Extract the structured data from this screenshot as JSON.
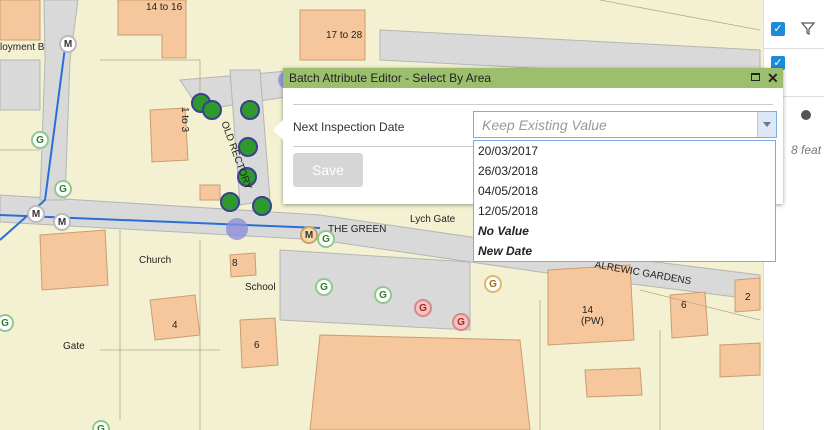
{
  "map": {
    "labels": {
      "house_14to16": "14 to 16",
      "house_17to28": "17 to 28",
      "employment": "loyment B",
      "road_1to3": "1 to 3",
      "old_rectory": "OLD RECTORY",
      "the_green": "THE GREEN",
      "lych_gate": "Lych Gate",
      "church": "Church",
      "school": "School",
      "num_8": "8",
      "num_4": "4",
      "num_6": "6",
      "num_6b": "6",
      "num_14": "14",
      "pw": "(PW)",
      "alrewic": "ALREWIC GARDENS",
      "gate": "Gate",
      "num_2": "2"
    },
    "markers": {
      "g": "G",
      "m": "M",
      "r": "G"
    }
  },
  "side": {
    "feature_count": "8 feat"
  },
  "dialog": {
    "title": "Batch Attribute Editor - Select By Area",
    "field_label": "Next Inspection Date",
    "combo_placeholder": "Keep Existing Value",
    "save_label": "Save",
    "close_glyph": "✕"
  },
  "dropdown": {
    "options": [
      "20/03/2017",
      "26/03/2018",
      "04/05/2018",
      "12/05/2018",
      "No Value",
      "New Date"
    ]
  },
  "colors": {
    "header": "#9cbf6d",
    "accent": "#1e8bd8",
    "selected_point": "#2e9a2e"
  }
}
